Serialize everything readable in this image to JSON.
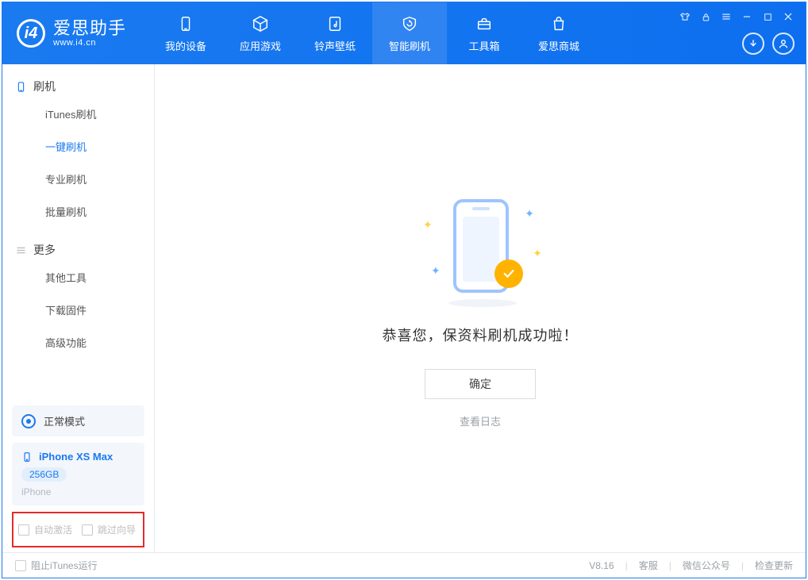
{
  "app": {
    "name_cn": "爱思助手",
    "url": "www.i4.cn"
  },
  "nav": {
    "tabs": [
      {
        "label": "我的设备",
        "icon": "device"
      },
      {
        "label": "应用游戏",
        "icon": "cube"
      },
      {
        "label": "铃声壁纸",
        "icon": "music"
      },
      {
        "label": "智能刷机",
        "icon": "refresh",
        "active": true
      },
      {
        "label": "工具箱",
        "icon": "toolbox"
      },
      {
        "label": "爱思商城",
        "icon": "bag"
      }
    ]
  },
  "sidebar": {
    "groups": [
      {
        "title": "刷机",
        "icon": "phone",
        "items": [
          {
            "label": "iTunes刷机"
          },
          {
            "label": "一键刷机",
            "active": true
          },
          {
            "label": "专业刷机"
          },
          {
            "label": "批量刷机"
          }
        ]
      },
      {
        "title": "更多",
        "icon": "menu",
        "items": [
          {
            "label": "其他工具"
          },
          {
            "label": "下载固件"
          },
          {
            "label": "高级功能"
          }
        ]
      }
    ],
    "status_label": "正常模式",
    "device": {
      "name": "iPhone XS Max",
      "storage": "256GB",
      "type": "iPhone"
    },
    "options": [
      {
        "label": "自动激活"
      },
      {
        "label": "跳过向导"
      }
    ]
  },
  "main": {
    "message": "恭喜您，保资料刷机成功啦！",
    "ok_label": "确定",
    "log_link": "查看日志"
  },
  "footer": {
    "itunes_block": "阻止iTunes运行",
    "version": "V8.16",
    "links": [
      "客服",
      "微信公众号",
      "检查更新"
    ]
  }
}
